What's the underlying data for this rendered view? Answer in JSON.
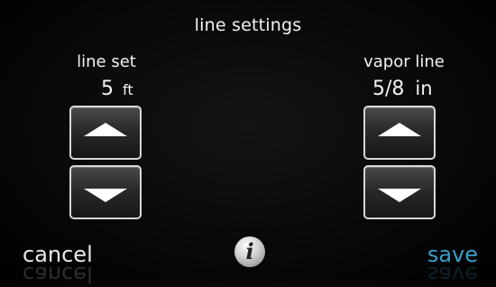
{
  "screen": {
    "title": "line settings"
  },
  "line_set": {
    "label": "line set",
    "value": "5",
    "unit": "ft"
  },
  "vapor_line": {
    "label": "vapor line",
    "value": "5/8",
    "unit": "in"
  },
  "footer": {
    "cancel_label": "cancel",
    "save_label": "save",
    "info_glyph": "i"
  },
  "colors": {
    "save": "#3a9fc7",
    "background": "#000000",
    "text": "#f2f2f2"
  }
}
